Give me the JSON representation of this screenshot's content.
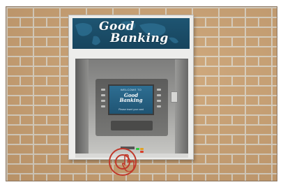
{
  "atm": {
    "banner_line1": "Good",
    "banner_line2": "Banking",
    "screen_welcome": "WELCOME TO",
    "screen_logo_line1": "Good",
    "screen_logo_line2": "Banking",
    "screen_prompt": "Please insert your card"
  },
  "colors": {
    "banner": "#1e5572",
    "marker": "#c0392b",
    "indicator_green": "#2ecc40",
    "indicator_amber": "#e0a021",
    "indicator_red": "#d9402c"
  },
  "icons": [
    "hand-pointer-icon",
    "target-marker-icon"
  ]
}
